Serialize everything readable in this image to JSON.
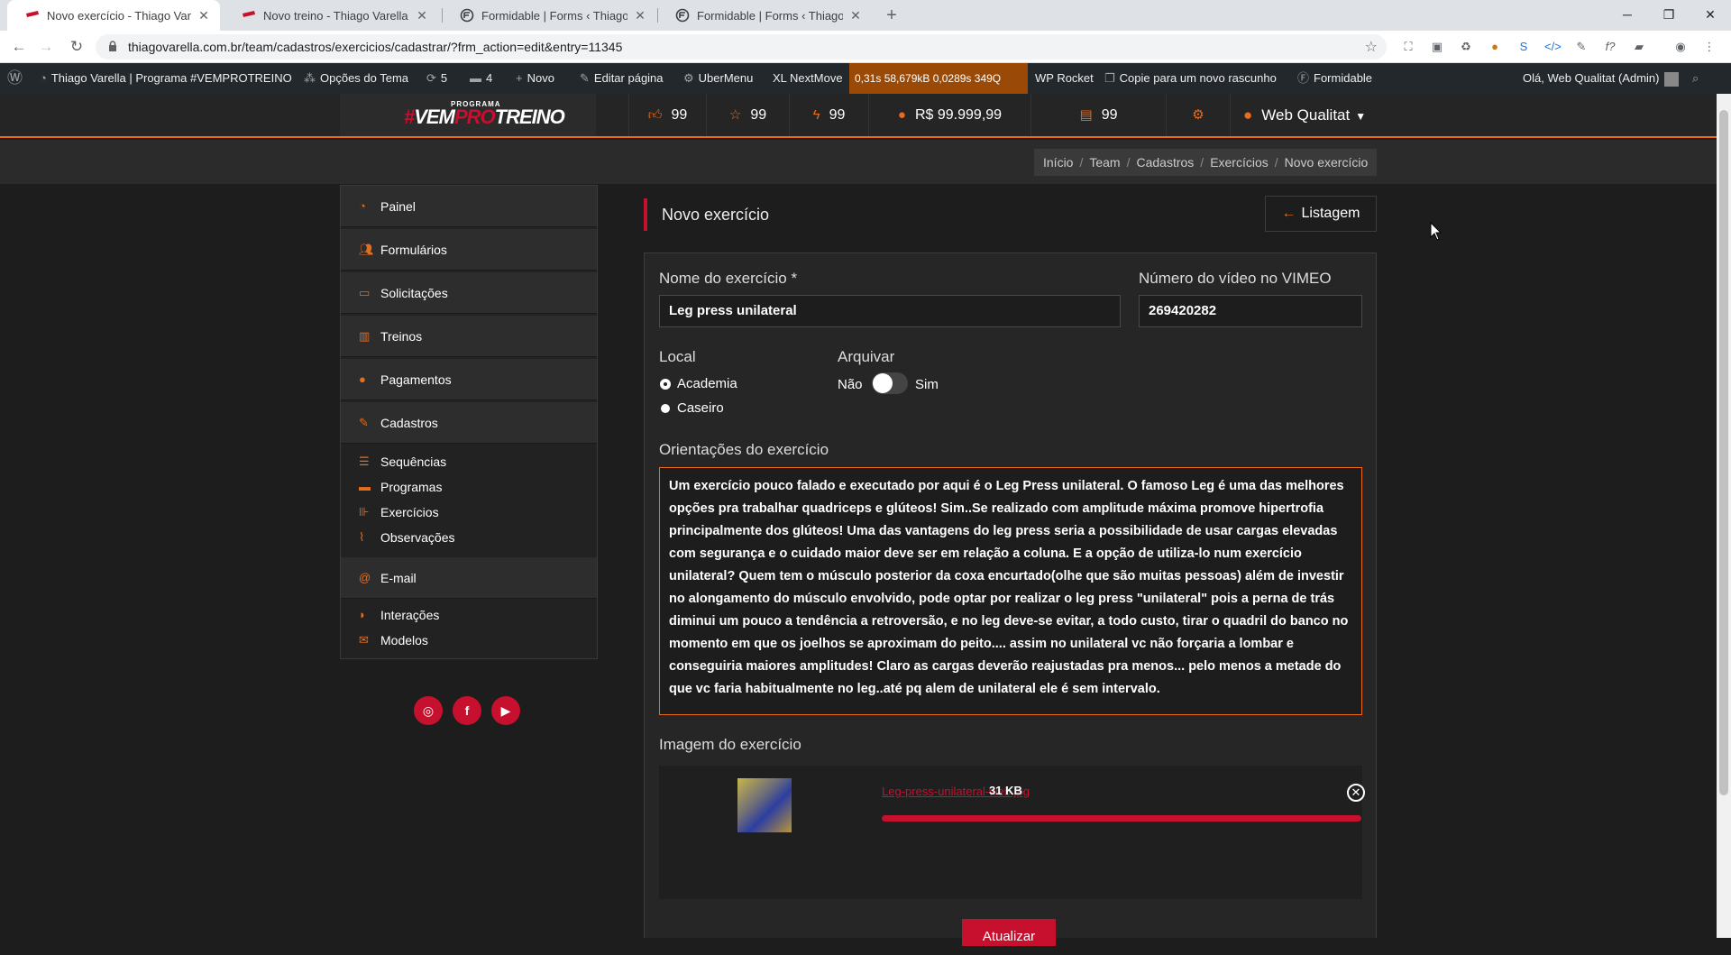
{
  "browser": {
    "tabs": [
      {
        "title": "Novo exercício - Thiago Varella |",
        "active": true
      },
      {
        "title": "Novo treino - Thiago Varella | Pr",
        "active": false
      },
      {
        "title": "Formidable | Forms ‹ Thiago Vare",
        "active": false
      },
      {
        "title": "Formidable | Forms ‹ Thiago Vare",
        "active": false
      }
    ],
    "url": "thiagovarella.com.br/team/cadastros/exercicios/cadastrar/?frm_action=edit&entry=11345"
  },
  "wpbar": {
    "site": "Thiago Varella | Programa #VEMPROTREINO",
    "theme_options": "Opções do Tema",
    "updates": "5",
    "comments": "4",
    "new": "Novo",
    "edit_page": "Editar página",
    "ubermenu": "UberMenu",
    "nextmove": "XL NextMove",
    "query_monitor": "0,31s  58,679kB  0,0289s  349Q",
    "wp_rocket": "WP Rocket",
    "copy_draft": "Copie para um novo rascunho",
    "formidable": "Formidable",
    "greeting": "Olá, Web Qualitat (Admin)"
  },
  "header": {
    "logo_top": "PROGRAMA",
    "logo_main": "#VEMPROTREINO",
    "stats": {
      "likes": "99",
      "stars": "99",
      "bolts": "99",
      "money": "R$ 99.999,99",
      "docs": "99"
    },
    "user": "Web Qualitat"
  },
  "breadcrumb": [
    "Início",
    "Team",
    "Cadastros",
    "Exercícios",
    "Novo exercício"
  ],
  "sidebar": {
    "painel": "Painel",
    "formularios": "Formulários",
    "solicitacoes": "Solicitações",
    "treinos": "Treinos",
    "pagamentos": "Pagamentos",
    "cadastros": "Cadastros",
    "cadastros_items": [
      "Sequências",
      "Programas",
      "Exercícios",
      "Observações"
    ],
    "email": "E-mail",
    "email_items": [
      "Interações",
      "Modelos"
    ]
  },
  "page": {
    "title": "Novo exercício",
    "list_button": "Listagem"
  },
  "form": {
    "name_label": "Nome do exercício",
    "name_required": "*",
    "name_value": "Leg press unilateral",
    "vimeo_label": "Número do vídeo no VIMEO",
    "vimeo_value": "269420282",
    "local_label": "Local",
    "local_options": [
      "Academia",
      "Caseiro"
    ],
    "local_selected": "Academia",
    "archive_label": "Arquivar",
    "archive_no": "Não",
    "archive_yes": "Sim",
    "archive_on": false,
    "orientations_label": "Orientações do exercício",
    "orientations_value": "Um exercício pouco falado e executado por aqui é o Leg Press unilateral. O famoso Leg é uma das melhores opções pra trabalhar quadriceps e glúteos! Sim..Se realizado com amplitude máxima promove hipertrofia principalmente dos glúteos! Uma das vantagens do leg press seria a possibilidade de usar cargas elevadas com segurança e o cuidado maior deve ser em relação a coluna. E a opção de utiliza-lo num exercício unilateral? Quem tem o músculo posterior da coxa encurtado(olhe que são muitas pessoas) além de investir no alongamento do músculo envolvido, pode optar por realizar o leg press \"unilateral\" pois a perna de trás diminui um pouco a tendência a retroversão, e no leg deve-se evitar, a todo custo, tirar o quadril do banco no momento em que os joelhos se aproximam do peito.... assim no unilateral vc não forçaria a lombar e conseguiria maiores amplitudes! Claro as cargas deverão reajustadas pra menos... pelo menos a metade do que vc faria habitualmente no leg..até pq alem de unilateral ele é sem intervalo.",
    "image_label": "Imagem do exercício",
    "file_name": "Leg-press-unilateral-web.jpg",
    "file_size": "31 KB",
    "upload_progress": 1.0,
    "save_button": "Atualizar"
  },
  "colors": {
    "accent": "#e86c1a",
    "brand": "#c6102e"
  }
}
